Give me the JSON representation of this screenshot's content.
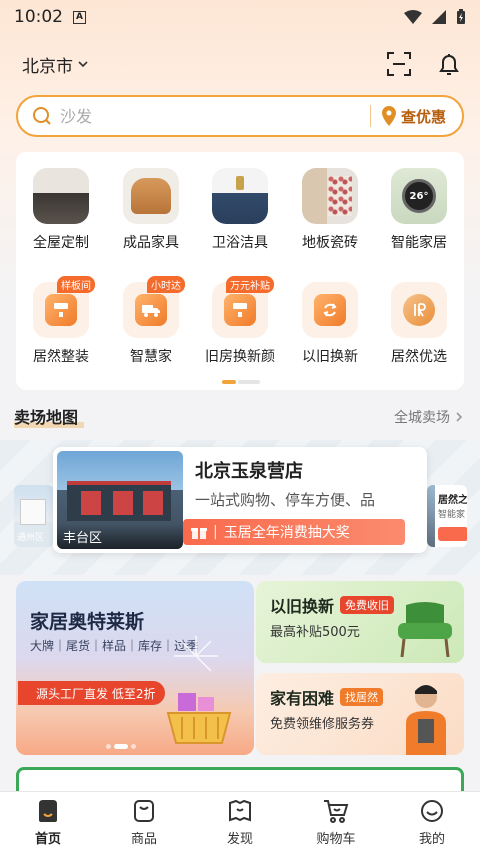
{
  "status_bar": {
    "time": "10:02"
  },
  "header": {
    "city": "北京市"
  },
  "search": {
    "placeholder": "沙发",
    "deal_label": "查优惠"
  },
  "categories": [
    {
      "label": "全屋定制"
    },
    {
      "label": "成品家具"
    },
    {
      "label": "卫浴洁具"
    },
    {
      "label": "地板瓷砖"
    },
    {
      "label": "智能家居",
      "display_value": "26°"
    }
  ],
  "services": [
    {
      "label": "居然整装",
      "tag": "样板间"
    },
    {
      "label": "智慧家",
      "tag": "小时达"
    },
    {
      "label": "旧房换新颜",
      "tag": "万元补贴"
    },
    {
      "label": "以旧换新",
      "tag": ""
    },
    {
      "label": "居然优选",
      "tag": ""
    }
  ],
  "map_section": {
    "title": "卖场地图",
    "more_label": "全城卖场",
    "left_card_district": "通州区",
    "right_card_title": "居然之",
    "right_card_sub": "智能家",
    "store": {
      "name": "北京玉泉营店",
      "district": "丰台区",
      "description": "一站式购物、停车方便、品",
      "promo": "玉居全年消费抽大奖"
    }
  },
  "banners": {
    "outlet": {
      "title": "家居奥特莱斯",
      "subtitle": "大牌｜尾货｜样品｜库存｜过季",
      "cta": "源头工厂直发  低至2折"
    },
    "trade_in": {
      "title": "以旧换新",
      "chip": "免费收旧",
      "subtitle": "最高补贴500元"
    },
    "repair": {
      "title": "家有困难",
      "chip": "找居然",
      "subtitle": "免费领维修服务券"
    }
  },
  "tabbar": {
    "items": [
      {
        "label": "首页",
        "active": true
      },
      {
        "label": "商品",
        "active": false
      },
      {
        "label": "发现",
        "active": false
      },
      {
        "label": "购物车",
        "active": false
      },
      {
        "label": "我的",
        "active": false
      }
    ]
  },
  "colors": {
    "accent": "#f2a33a",
    "promo_red": "#f96a4c",
    "deal_text": "#b85f0e",
    "trade_in_chip": "#e8462c",
    "repair_chip": "#f07b2a"
  }
}
